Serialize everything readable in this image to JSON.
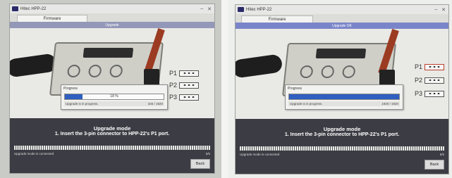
{
  "left_window": {
    "title": "Hitec HPP-22",
    "tab_label": "Firmware",
    "header": "Upgrade",
    "ports": [
      "P1",
      "P2",
      "P3"
    ],
    "progress": {
      "title": "Progress",
      "percent_text": "18 %",
      "fraction": 0.18,
      "status_text": "Upgrade is in progress.",
      "count_text": "345 / 1920"
    },
    "mode_title": "Upgrade mode",
    "mode_step": "1. Insert the 3-pin connector to HPP-22's P1 port.",
    "status_left": "Upgrade mode is connected",
    "status_right": "5/5",
    "back_label": "Back"
  },
  "right_window": {
    "title": "Hitec HPP-22",
    "tab_label": "Firmware",
    "header": "Upgrade OK",
    "ports": [
      "P1",
      "P2",
      "P3"
    ],
    "progress": {
      "title": "Progress",
      "percent_text": "",
      "fraction": 1.0,
      "status_text": "Upgrade is in progress.",
      "count_text": "1920 / 1920"
    },
    "mode_title": "Upgrade mode",
    "mode_step": "1. Insert the 3-pin connector to HPP-22's P1 port.",
    "status_left": "Upgrade mode is connected",
    "status_right": "5/5",
    "back_label": "Back"
  },
  "colors": {
    "progress_fill": "#2f5fc0",
    "bottom_panel": "#3c3c44",
    "header_strip": "#7a85c9"
  }
}
